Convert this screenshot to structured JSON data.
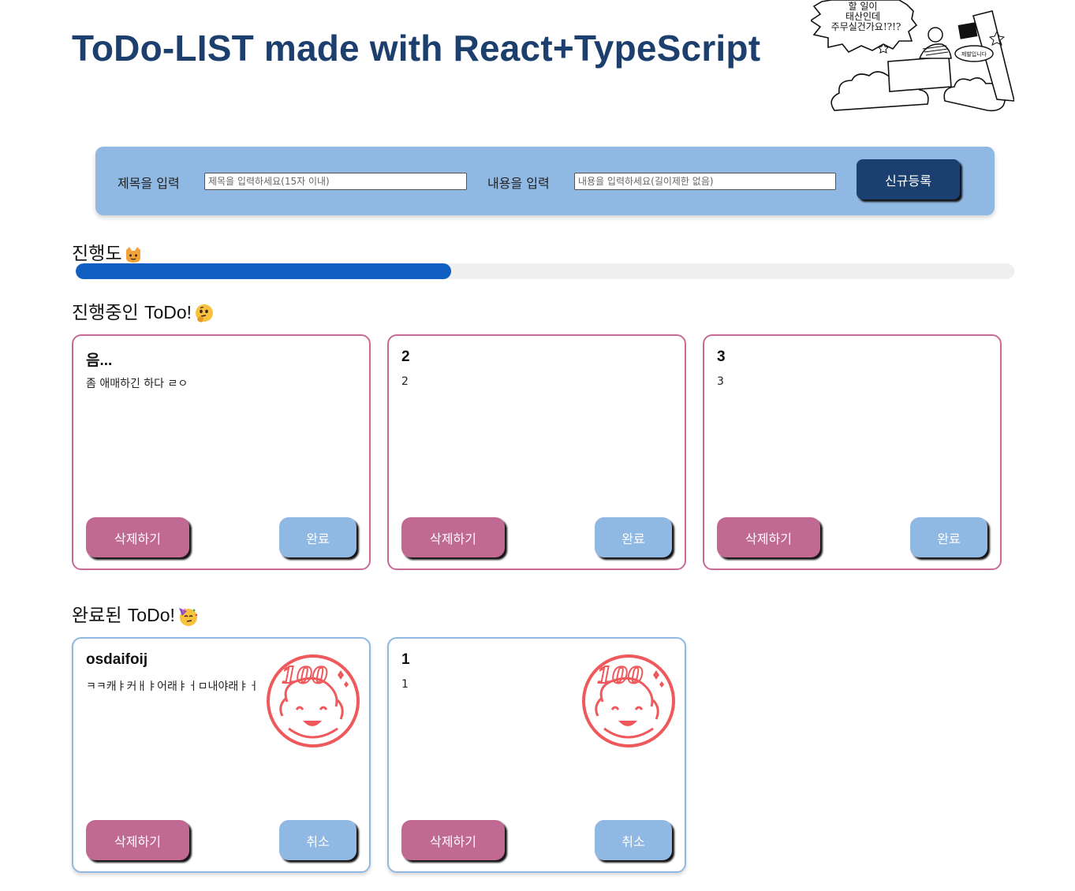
{
  "header": {
    "title": "ToDo-LIST made with React+TypeScript",
    "comic_text": [
      "할 일이",
      "태산인데",
      "주무실건가요!?!?"
    ],
    "comic_sign": "제발입니다"
  },
  "form": {
    "title_label": "제목을 입력",
    "title_placeholder": "제목을 입력하세요(15자 이내)",
    "title_value": "",
    "content_label": "내용을 입력",
    "content_placeholder": "내용을 입력하세요(길이제한 없음)",
    "content_value": "",
    "submit_label": "신규등록"
  },
  "progress": {
    "label": "진행도",
    "emoji_icon": "cat-face-icon",
    "fill_percent": 40
  },
  "in_progress": {
    "label_ko": "진행중인 ",
    "label_en": "ToDo!",
    "emoji_icon": "thinking-face-icon",
    "cards": [
      {
        "title": "음...",
        "body": "좀 애매하긴 하다 ㄹㅇ",
        "delete_label": "삭제하기",
        "action_label": "완료"
      },
      {
        "title": "2",
        "body": "2",
        "delete_label": "삭제하기",
        "action_label": "완료"
      },
      {
        "title": "3",
        "body": "3",
        "delete_label": "삭제하기",
        "action_label": "완료"
      }
    ]
  },
  "completed": {
    "label_ko": "완료된 ",
    "label_en": "ToDo!",
    "emoji_icon": "partying-face-icon",
    "stamp_text": "100",
    "cards": [
      {
        "title": "osdaifoij",
        "body": "ㅋㅋ캐ㅑ커ㅐㅑ어래ㅑㅓㅁ내야래ㅑㅓ",
        "delete_label": "삭제하기",
        "action_label": "취소"
      },
      {
        "title": "1",
        "body": "1",
        "delete_label": "삭제하기",
        "action_label": "취소"
      }
    ]
  },
  "colors": {
    "title_navy": "#1c3f6e",
    "form_blue": "#8fb8e3",
    "pink": "#c06a93",
    "progress_blue": "#0f5ec1",
    "stamp_red": "#f0595c"
  }
}
